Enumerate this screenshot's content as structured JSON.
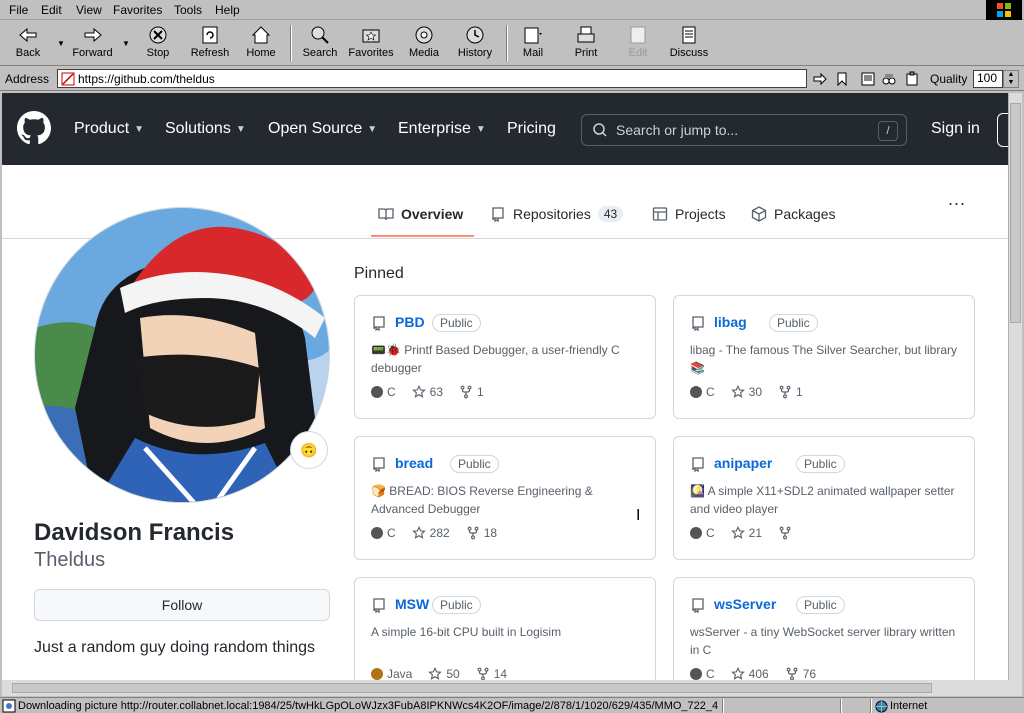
{
  "menu": [
    "File",
    "Edit",
    "View",
    "Favorites",
    "Tools",
    "Help"
  ],
  "toolbar": {
    "back": "Back",
    "forward": "Forward",
    "stop": "Stop",
    "refresh": "Refresh",
    "home": "Home",
    "search": "Search",
    "favorites": "Favorites",
    "media": "Media",
    "history": "History",
    "mail": "Mail",
    "print": "Print",
    "edit": "Edit",
    "discuss": "Discuss"
  },
  "address": {
    "label": "Address",
    "url": "https://github.com/theldus",
    "quality_label": "Quality",
    "quality_value": "100"
  },
  "github": {
    "nav": [
      "Product",
      "Solutions",
      "Open Source",
      "Enterprise",
      "Pricing"
    ],
    "search_placeholder": "Search or jump to...",
    "search_key": "/",
    "signin": "Sign in"
  },
  "tabs": {
    "overview": "Overview",
    "repositories": "Repositories",
    "repo_count": "43",
    "projects": "Projects",
    "packages": "Packages",
    "more": "..."
  },
  "profile": {
    "name": "Davidson Francis",
    "login": "Theldus",
    "follow": "Follow",
    "bio": "Just a random guy doing random things",
    "status_emoji": "🙃"
  },
  "pinned": {
    "title": "Pinned",
    "repos": [
      {
        "name": "PBD",
        "visibility": "Public",
        "desc": "📟🐞 Printf Based Debugger, a user-friendly C debugger",
        "lang": "C",
        "lang_color": "#555555",
        "stars": "63",
        "forks": "1"
      },
      {
        "name": "libag",
        "visibility": "Public",
        "desc": "libag - The famous The Silver Searcher, but library 📚",
        "lang": "C",
        "lang_color": "#555555",
        "stars": "30",
        "forks": "1"
      },
      {
        "name": "bread",
        "visibility": "Public",
        "desc": "🍞 BREAD: BIOS Reverse Engineering & Advanced Debugger",
        "lang": "C",
        "lang_color": "#555555",
        "stars": "282",
        "forks": "18"
      },
      {
        "name": "anipaper",
        "visibility": "Public",
        "desc": "🎑 A simple X11+SDL2 animated wallpaper setter and video player",
        "lang": "C",
        "lang_color": "#555555",
        "stars": "21",
        "forks": ""
      },
      {
        "name": "MSW",
        "visibility": "Public",
        "desc": "A simple 16-bit CPU built in Logisim",
        "lang": "Java",
        "lang_color": "#b07219",
        "stars": "50",
        "forks": "14"
      },
      {
        "name": "wsServer",
        "visibility": "Public",
        "desc": "wsServer - a tiny WebSocket server library written in C",
        "lang": "C",
        "lang_color": "#555555",
        "stars": "406",
        "forks": "76"
      }
    ]
  },
  "status": {
    "text": "Downloading picture http://router.collabnet.local:1984/25/twHkLGpOLoWJzx3FubA8IPKNWcs4K2OF/image/2/878/1/1020/629/435/MMO_722_4",
    "zone": "Internet"
  }
}
